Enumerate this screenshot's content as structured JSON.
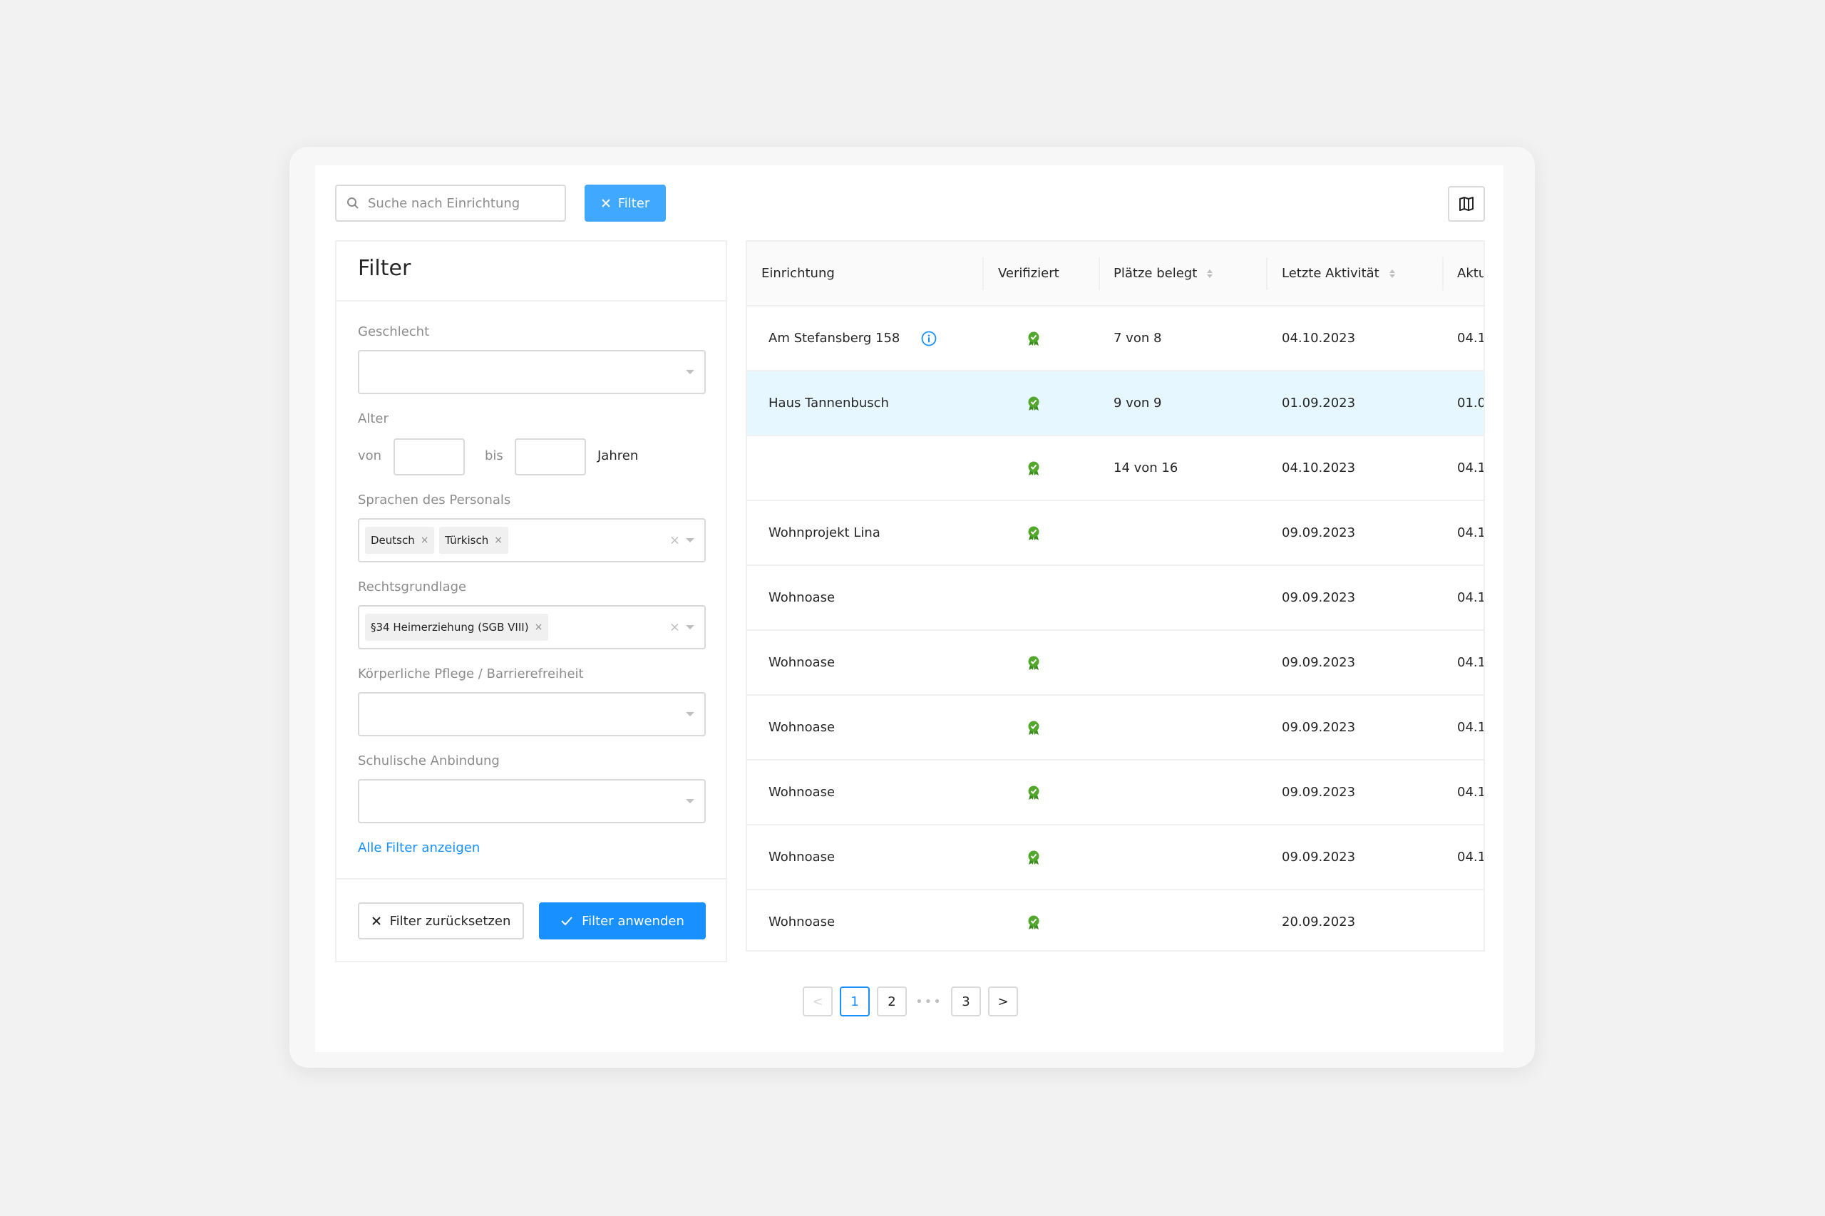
{
  "search": {
    "placeholder": "Suche nach Einrichtung"
  },
  "toolbar": {
    "filter_label": "Filter"
  },
  "filter_panel": {
    "title": "Filter",
    "gender_label": "Geschlecht",
    "age_label": "Alter",
    "age_from": "von",
    "age_to": "bis",
    "age_unit": "Jahren",
    "languages_label": "Sprachen des Personals",
    "languages": [
      "Deutsch",
      "Türkisch"
    ],
    "legal_label": "Rechtsgrundlage",
    "legal": [
      "§34 Heimerziehung (SGB VIII)"
    ],
    "care_label": "Körperliche Pflege / Barrierefreiheit",
    "school_label": "Schulische Anbindung",
    "show_all": "Alle Filter anzeigen",
    "reset": "Filter zurücksetzen",
    "apply": "Filter anwenden"
  },
  "table": {
    "headers": [
      "Einrichtung",
      "Verifiziert",
      "Plätze belegt",
      "Letzte Aktivität",
      "Aktu"
    ],
    "rows": [
      {
        "name": "Am Stefansberg 158",
        "info": true,
        "verified": true,
        "places": "7 von 8",
        "activity": "04.10.2023",
        "current": "04.1(",
        "selected": false
      },
      {
        "name": "Haus Tannenbusch",
        "info": false,
        "verified": true,
        "places": "9 von 9",
        "activity": "01.09.2023",
        "current": "01.0¹",
        "selected": true
      },
      {
        "name": "",
        "info": false,
        "verified": true,
        "places": "14 von 16",
        "activity": "04.10.2023",
        "current": "04.1(",
        "selected": false
      },
      {
        "name": "Wohnprojekt Lina",
        "info": false,
        "verified": true,
        "places": "",
        "activity": "09.09.2023",
        "current": "04.1(",
        "selected": false
      },
      {
        "name": "Wohnoase",
        "info": false,
        "verified": false,
        "places": "",
        "activity": "09.09.2023",
        "current": "04.1(",
        "selected": false
      },
      {
        "name": "Wohnoase",
        "info": false,
        "verified": true,
        "places": "",
        "activity": "09.09.2023",
        "current": "04.1(",
        "selected": false
      },
      {
        "name": "Wohnoase",
        "info": false,
        "verified": true,
        "places": "",
        "activity": "09.09.2023",
        "current": "04.1(",
        "selected": false
      },
      {
        "name": "Wohnoase",
        "info": false,
        "verified": true,
        "places": "",
        "activity": "09.09.2023",
        "current": "04.1(",
        "selected": false
      },
      {
        "name": "Wohnoase",
        "info": false,
        "verified": true,
        "places": "",
        "activity": "09.09.2023",
        "current": "04.1(",
        "selected": false
      },
      {
        "name": "Wohnoase",
        "info": false,
        "verified": true,
        "places": "",
        "activity": "20.09.2023",
        "current": "",
        "selected": false
      }
    ]
  },
  "pagination": {
    "pages": [
      "1",
      "2",
      "3"
    ],
    "dots": "•••",
    "prev": "<",
    "next": ">"
  },
  "colors": {
    "primary": "#1890ff",
    "filter_button": "#40a9ff",
    "verified": "#52a82c",
    "selected_row": "#e6f7ff"
  }
}
